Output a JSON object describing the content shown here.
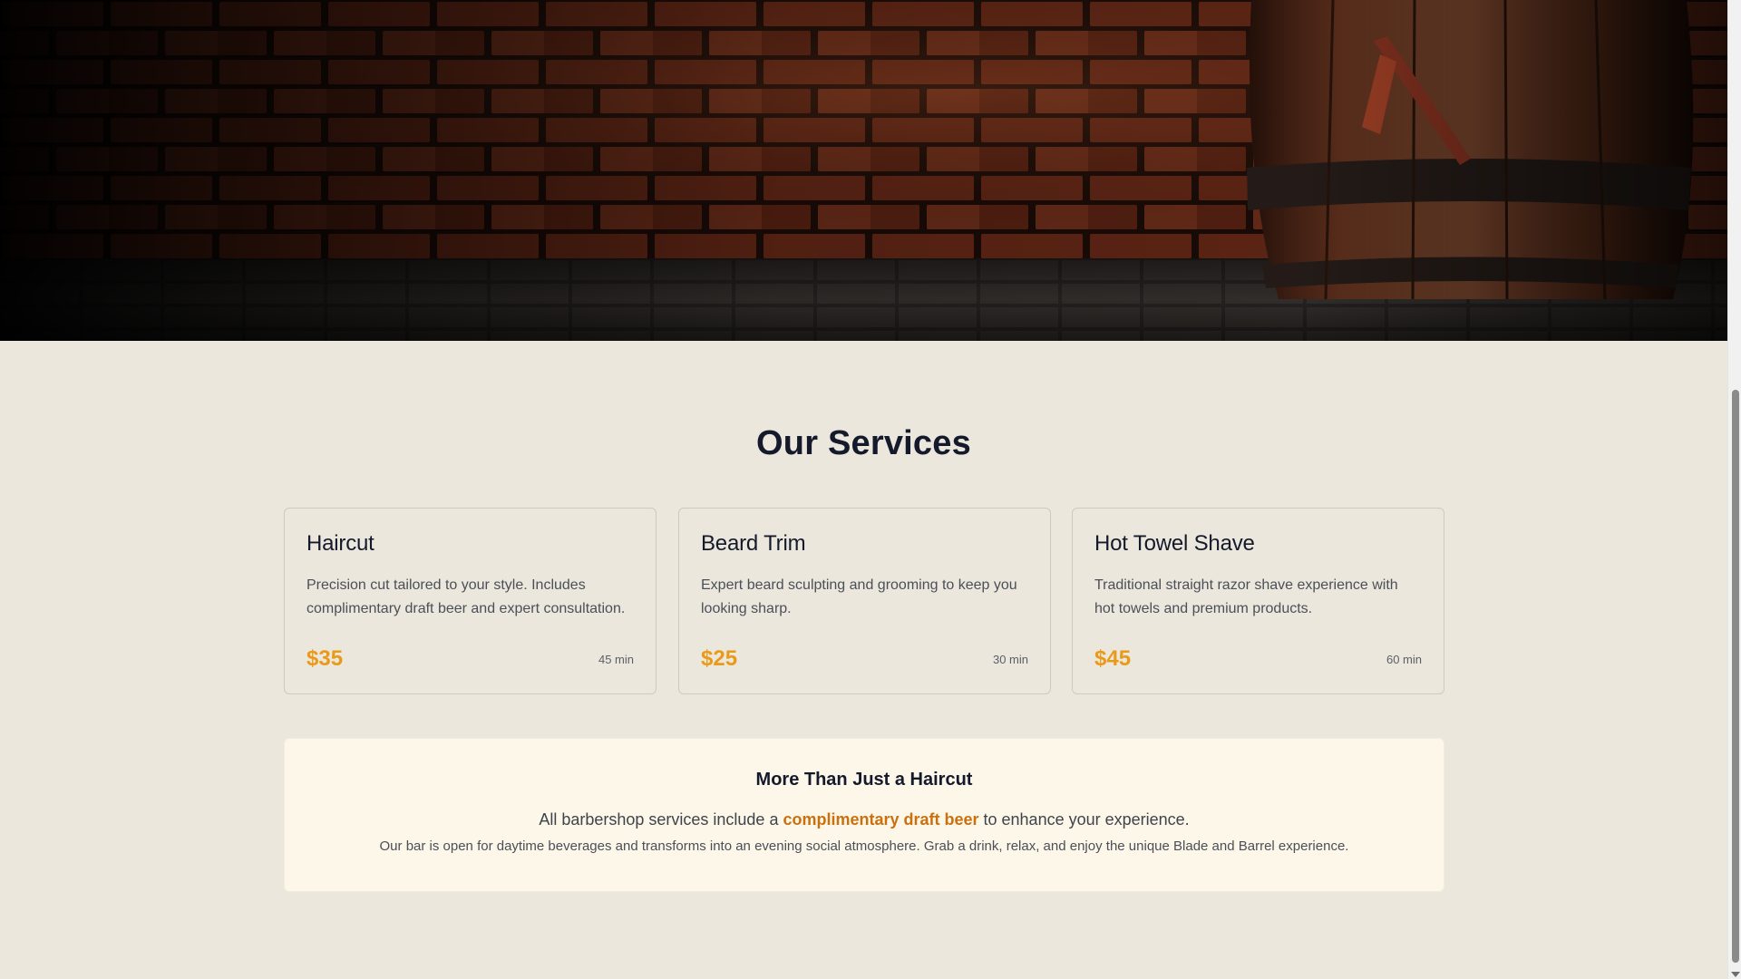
{
  "services": {
    "title": "Our Services",
    "items": [
      {
        "name": "Haircut",
        "description": "Precision cut tailored to your style. Includes complimentary draft beer and expert consultation.",
        "price": "$35",
        "duration": "45 min"
      },
      {
        "name": "Beard Trim",
        "description": "Expert beard sculpting and grooming to keep you looking sharp.",
        "price": "$25",
        "duration": "30 min"
      },
      {
        "name": "Hot Towel Shave",
        "description": "Traditional straight razor shave experience with hot towels and premium products.",
        "price": "$45",
        "duration": "60 min"
      }
    ]
  },
  "promo": {
    "title": "More Than Just a Haircut",
    "line_before": "All barbershop services include a ",
    "highlight": "complimentary draft beer",
    "line_after": " to enhance your experience.",
    "sub": "Our bar is open for daytime beverages and transforms into an evening social atmosphere. Grab a drink, relax, and enjoy the unique Blade and Barrel experience."
  },
  "colors": {
    "page_background": "#ece7dd",
    "heading": "#141a2b",
    "price_accent": "#e99a18",
    "highlight_accent": "#c9700f",
    "promo_background": "#fdf7ea"
  },
  "hero": {
    "image": "brick-wall-barrel-razor-photo"
  }
}
